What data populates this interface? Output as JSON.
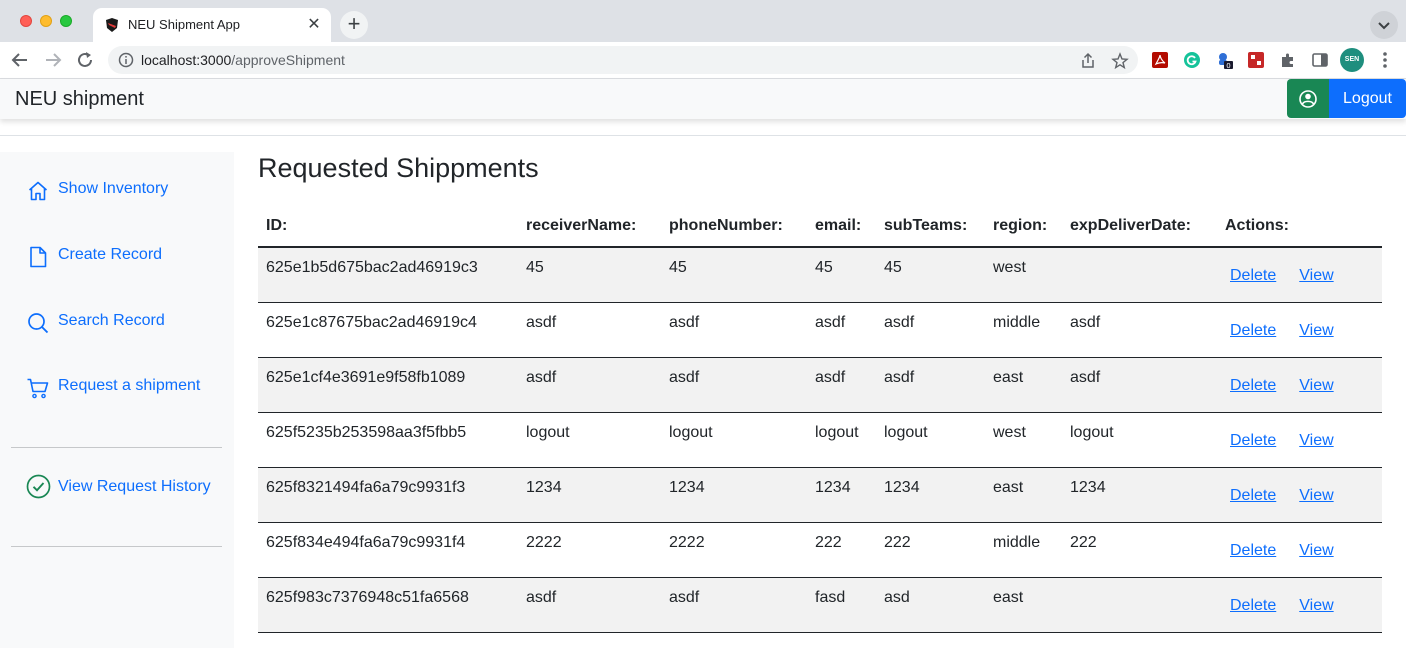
{
  "browser": {
    "tab_title": "NEU Shipment App",
    "url_host": "localhost:3000",
    "url_path": "/approveShipment",
    "avatar_initials": "SEN",
    "extension_badge": "0"
  },
  "navbar": {
    "brand": "NEU shipment",
    "logout_label": "Logout"
  },
  "sidebar": {
    "items": [
      {
        "label": "Show Inventory",
        "icon": "house-icon"
      },
      {
        "label": "Create Record",
        "icon": "file-icon"
      },
      {
        "label": "Search Record",
        "icon": "search-icon"
      },
      {
        "label": "Request a shipment",
        "icon": "cart-icon"
      },
      {
        "label": "View Request History",
        "icon": "check-circle-icon"
      }
    ]
  },
  "main": {
    "title": "Requested Shippments",
    "columns": [
      "ID:",
      "receiverName:",
      "phoneNumber:",
      "email:",
      "subTeams:",
      "region:",
      "expDeliverDate:",
      "Actions:"
    ],
    "delete_label": "Delete",
    "view_label": "View",
    "rows": [
      {
        "id": "625e1b5d675bac2ad46919c3",
        "receiverName": "45",
        "phoneNumber": "45",
        "email": "45",
        "subTeams": "45",
        "region": "west",
        "expDeliverDate": ""
      },
      {
        "id": "625e1c87675bac2ad46919c4",
        "receiverName": "asdf",
        "phoneNumber": "asdf",
        "email": "asdf",
        "subTeams": "asdf",
        "region": "middle",
        "expDeliverDate": "asdf"
      },
      {
        "id": "625e1cf4e3691e9f58fb1089",
        "receiverName": "asdf",
        "phoneNumber": "asdf",
        "email": "asdf",
        "subTeams": "asdf",
        "region": "east",
        "expDeliverDate": "asdf"
      },
      {
        "id": "625f5235b253598aa3f5fbb5",
        "receiverName": "logout",
        "phoneNumber": "logout",
        "email": "logout",
        "subTeams": "logout",
        "region": "west",
        "expDeliverDate": "logout"
      },
      {
        "id": "625f8321494fa6a79c9931f3",
        "receiverName": "1234",
        "phoneNumber": "1234",
        "email": "1234",
        "subTeams": "1234",
        "region": "east",
        "expDeliverDate": "1234"
      },
      {
        "id": "625f834e494fa6a79c9931f4",
        "receiverName": "2222",
        "phoneNumber": "2222",
        "email": "222",
        "subTeams": "222",
        "region": "middle",
        "expDeliverDate": "222"
      },
      {
        "id": "625f983c7376948c51fa6568",
        "receiverName": "asdf",
        "phoneNumber": "asdf",
        "email": "fasd",
        "subTeams": "asd",
        "region": "east",
        "expDeliverDate": ""
      }
    ]
  },
  "colors": {
    "link": "#0d6efd",
    "success": "#198754",
    "primary": "#0d6efd"
  }
}
